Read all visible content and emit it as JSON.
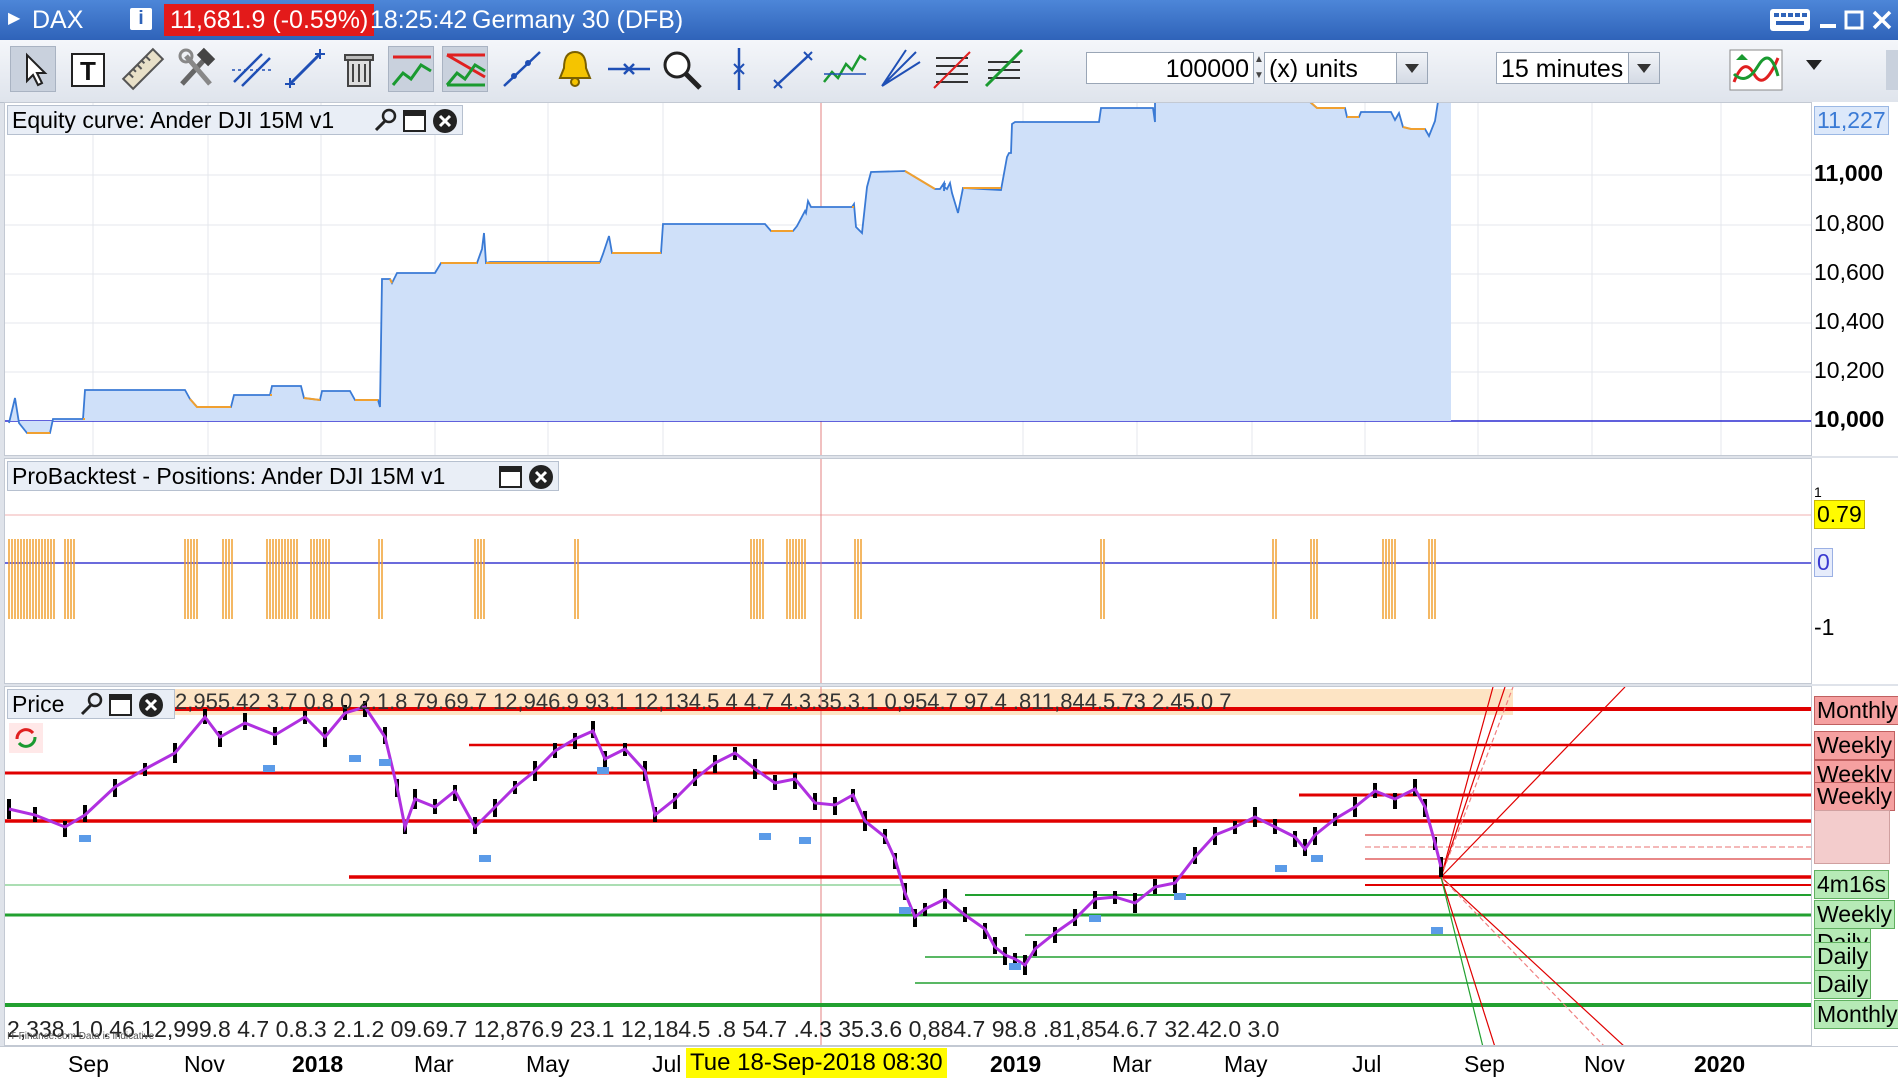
{
  "titlebar": {
    "symbol": "DAX",
    "price_change": "11,681.9 (-0.59%)",
    "time": "18:25:42",
    "instrument": "Germany 30 (DFB)"
  },
  "toolbar": {
    "quantity": "100000",
    "units": "(x) units",
    "timeframe": "15 minutes"
  },
  "panels": {
    "equity": {
      "title": "Equity curve: Ander DJI 15M v1",
      "axis_labels": [
        "11,000",
        "10,800",
        "10,600",
        "10,400",
        "10,200",
        "10,000"
      ],
      "current_value": "11,227"
    },
    "positions": {
      "title": "ProBacktest - Positions: Ander DJI 15M v1",
      "axis_top": "1",
      "axis_mid": "0.79",
      "axis_zero": "0",
      "axis_bottom": "-1"
    },
    "price": {
      "title": "Price",
      "top_strip": "2,955.42 3.7 0.8 0 2.1.8 79.69.7 12,946.9 93.1 12,134.5 4 4.7 4.3.35.3.1 0,954.7 97.4 .811,844.5.73 2.45.0 7",
      "bottom_strip": "2,338.1 0.46 12,999.8 4.7 0.8.3 2.1.2 09.69.7 12,876.9 23.1 12,184.5 .8 54.7 .4.3 35.3.6 0,884.7 98.8 .81,854.6.7 32.42.0 3.0",
      "watermark": "IT-Finance.com  Data is indicative",
      "right_labels": [
        "Monthly",
        "Weekly",
        "Weekly",
        "Weekly",
        "4m16s",
        "Weekly",
        "Daily",
        "Daily",
        "Monthly"
      ]
    }
  },
  "xaxis": {
    "months": [
      "Sep",
      "Nov",
      "2018",
      "Mar",
      "May",
      "Jul",
      "2019",
      "Mar",
      "May",
      "Jul",
      "Sep",
      "Nov",
      "2020"
    ],
    "cursor_date": "Tue 18-Sep-2018 08:30"
  },
  "colors": {
    "equity_fill": "#cfe0f9",
    "equity_gain": "#3a7ad5",
    "equity_flat": "#f0a030",
    "monthly_line": "#e00000",
    "support_line": "#22a030",
    "price_ma": "#b030e0"
  }
}
